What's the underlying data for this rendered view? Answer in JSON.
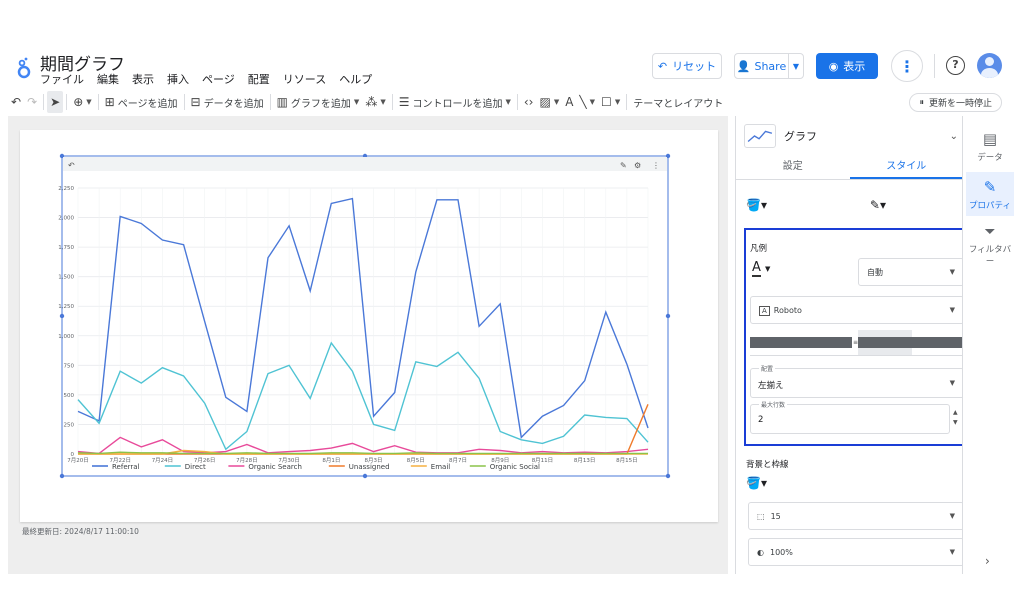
{
  "header": {
    "title": "期間グラフ",
    "menus": [
      "ファイル",
      "編集",
      "表示",
      "挿入",
      "ページ",
      "配置",
      "リソース",
      "ヘルプ"
    ],
    "reset_label": "リセット",
    "share_label": "Share",
    "view_label": "表示"
  },
  "toolbar": {
    "add_page": "ページを追加",
    "add_data": "データを追加",
    "add_chart": "グラフを追加",
    "add_control": "コントロールを追加",
    "theme": "テーマとレイアウト",
    "pause": "更新を一時停止"
  },
  "canvas": {
    "updated": "最終更新日: 2024/8/17 11:00:10"
  },
  "properties": {
    "chart_type": "グラフ",
    "tabs": [
      "設定",
      "スタイル"
    ],
    "active_tab": "スタイル",
    "legend_label": "凡例",
    "font_size": "自動",
    "font_family": "Roboto",
    "align_caption": "配置",
    "align_value": "左揃え",
    "max_lines_caption": "最大行数",
    "max_lines_value": "2",
    "bg_label": "背景と枠線",
    "radius_value": "15",
    "opacity_value": "100%"
  },
  "rail": {
    "items": [
      "データ",
      "プロパティ",
      "フィルタバー"
    ],
    "active": "プロパティ"
  },
  "chart_data": {
    "type": "line",
    "x": [
      "7月20日",
      "7月21日",
      "7月22日",
      "7月23日",
      "7月24日",
      "7月25日",
      "7月26日",
      "7月27日",
      "7月28日",
      "7月29日",
      "7月30日",
      "7月31日",
      "8月1日",
      "8月2日",
      "8月3日",
      "8月4日",
      "8月5日",
      "8月6日",
      "8月7日",
      "8月8日",
      "8月9日",
      "8月10日",
      "8月11日",
      "8月12日",
      "8月13日",
      "8月14日",
      "8月15日",
      "8月16日"
    ],
    "xticks": [
      "7月20日",
      "7月22日",
      "7月24日",
      "7月26日",
      "7月28日",
      "7月30日",
      "8月1日",
      "8月3日",
      "8月5日",
      "8月7日",
      "8月9日",
      "8月11日",
      "8月13日",
      "8月15日"
    ],
    "ylim": [
      0,
      2250
    ],
    "yticks": [
      "0",
      "250",
      "500",
      "750",
      "1,000",
      "1,250",
      "1,500",
      "1,750",
      "2,000",
      "2,250"
    ],
    "series": [
      {
        "name": "Referral",
        "color": "#4a78d8",
        "values": [
          360,
          280,
          2010,
          1950,
          1810,
          1770,
          1120,
          480,
          360,
          1660,
          1930,
          1380,
          2120,
          2160,
          320,
          520,
          1540,
          2150,
          2150,
          1080,
          1270,
          140,
          320,
          410,
          620,
          1200,
          760,
          220
        ]
      },
      {
        "name": "Direct",
        "color": "#4fc3d3",
        "values": [
          460,
          260,
          700,
          600,
          730,
          660,
          430,
          40,
          190,
          680,
          750,
          470,
          940,
          700,
          250,
          200,
          780,
          740,
          860,
          640,
          190,
          120,
          90,
          150,
          330,
          310,
          300,
          100
        ]
      },
      {
        "name": "Organic Search",
        "color": "#e84a9a",
        "values": [
          20,
          5,
          140,
          60,
          120,
          20,
          10,
          20,
          80,
          10,
          20,
          30,
          50,
          90,
          20,
          70,
          15,
          10,
          10,
          40,
          30,
          10,
          20,
          10,
          15,
          10,
          20,
          40
        ]
      },
      {
        "name": "Unassigned",
        "color": "#f07b2c",
        "values": [
          0,
          0,
          0,
          0,
          0,
          0,
          0,
          0,
          0,
          0,
          0,
          0,
          0,
          0,
          0,
          0,
          0,
          0,
          0,
          0,
          0,
          0,
          0,
          0,
          0,
          0,
          0,
          420
        ]
      },
      {
        "name": "Email",
        "color": "#f5b041",
        "values": [
          0,
          0,
          0,
          0,
          0,
          30,
          20,
          0,
          0,
          0,
          0,
          0,
          0,
          0,
          0,
          0,
          0,
          0,
          0,
          0,
          0,
          0,
          0,
          0,
          0,
          0,
          0,
          0
        ]
      },
      {
        "name": "Organic Social",
        "color": "#8bc34a",
        "values": [
          10,
          5,
          15,
          10,
          10,
          5,
          5,
          5,
          10,
          5,
          5,
          5,
          10,
          10,
          5,
          5,
          10,
          5,
          5,
          5,
          5,
          5,
          5,
          5,
          5,
          5,
          5,
          5
        ]
      }
    ]
  }
}
